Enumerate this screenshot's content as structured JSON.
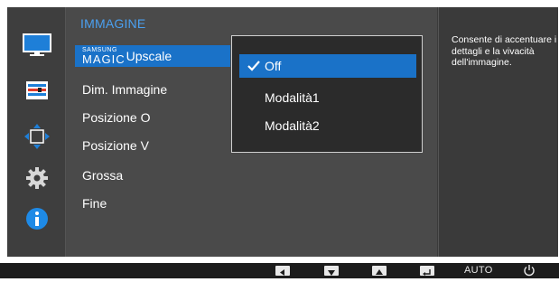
{
  "menu": {
    "title": "IMMAGINE",
    "items": [
      {
        "label_top": "SAMSUNG",
        "label_magic": "MAGIC",
        "label": "Upscale"
      },
      {
        "label": "Dim. Immagine"
      },
      {
        "label": "Posizione O"
      },
      {
        "label": "Posizione V"
      },
      {
        "label": "Grossa"
      },
      {
        "label": "Fine"
      }
    ]
  },
  "submenu": {
    "options": [
      "Off",
      "Modalità1",
      "Modalità2"
    ],
    "selected": "Off"
  },
  "help": {
    "text": "Consente di accentuare i dettagli e la vivacità dell'immagine."
  },
  "buttons": {
    "auto": "AUTO"
  },
  "colors": {
    "accent": "#1a72c8",
    "title": "#4aa0f0",
    "info_icon": "#1e8ae6"
  },
  "icons": [
    "monitor-icon",
    "color-bars-icon",
    "resize-arrows-icon",
    "gear-icon",
    "info-icon"
  ]
}
